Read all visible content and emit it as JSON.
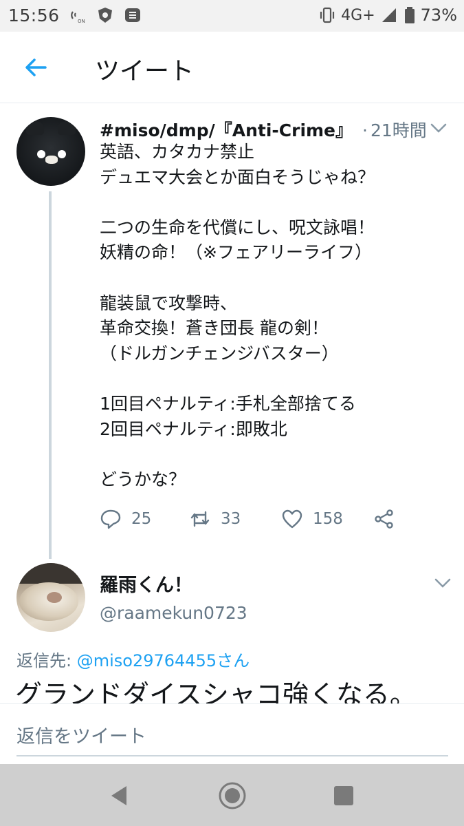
{
  "status_bar": {
    "time": "15:56",
    "network": "4G+",
    "battery": "73%"
  },
  "header": {
    "title": "ツイート"
  },
  "tweet": {
    "display_name": "#miso/dmp/『Anti-Crime』",
    "separator": "·",
    "time_ago": "21時間",
    "lines": [
      "英語、カタカナ禁止",
      "デュエマ大会とか面白そうじゃね？",
      "",
      "二つの生命を代償にし、呪文詠唱！",
      "妖精の命！（※フェアリーライフ）",
      "",
      "龍装鼠で攻撃時、",
      "革命交換！蒼き団長 龍の剣！",
      "（ドルガンチェンジバスター）",
      "",
      "1回目ペナルティ:手札全部捨てる",
      "2回目ペナルティ:即敗北",
      "",
      "どうかな？"
    ],
    "reply_count": "25",
    "retweet_count": "33",
    "like_count": "158"
  },
  "reply": {
    "display_name": "羅雨くん！",
    "handle": "@raamekun0723",
    "replying_label": "返信先: ",
    "replying_to": "@miso29764455さん",
    "text": "グランドダイスシャコ強くなる。"
  },
  "compose": {
    "placeholder": "返信をツイート"
  },
  "colors": {
    "accent": "#1da1f2",
    "secondary_text": "#657786",
    "thread_line": "#ccd6dd"
  }
}
